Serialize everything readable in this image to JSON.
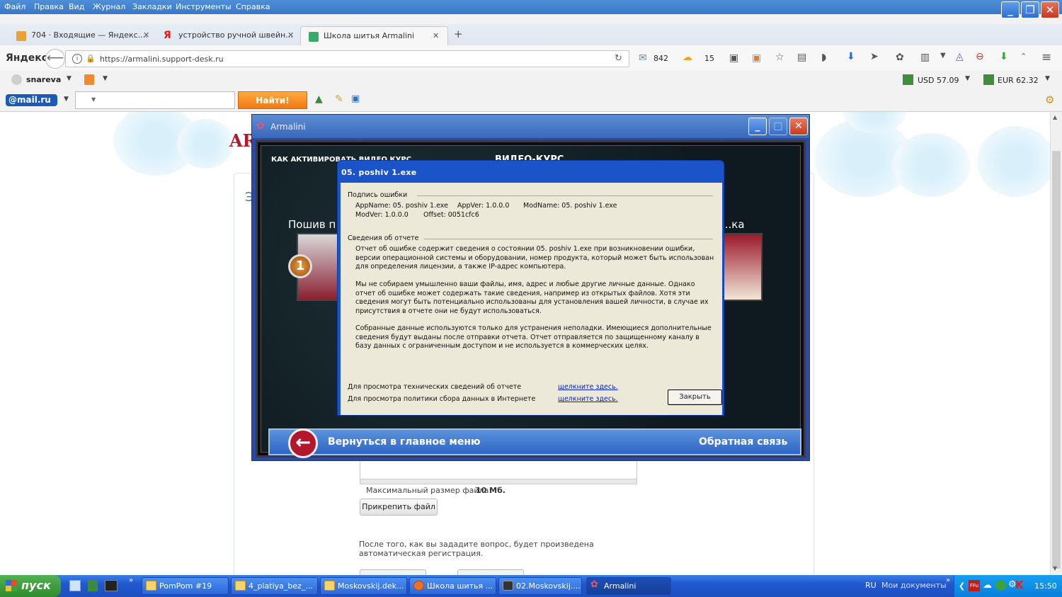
{
  "browser": {
    "menu": [
      "Файл",
      "Правка",
      "Вид",
      "Журнал",
      "Закладки",
      "Инструменты",
      "Справка"
    ],
    "tabs": [
      {
        "label": "704 · Входящие — Яндекс...."
      },
      {
        "label": "устройство ручной швейн..."
      },
      {
        "label": "Школа шитья Armalini"
      }
    ],
    "new_tab": "+",
    "yandex_label": "Яндекс",
    "url": "https://armalini.support-desk.ru",
    "mail_count": "842",
    "weather": "15",
    "user": "snareva",
    "usd": "USD 57.09",
    "eur": "EUR 62.32",
    "mailru_label": "@mail.ru",
    "search_value": "",
    "find_button": "Найти!"
  },
  "page": {
    "logo_partial": "AR",
    "cut_text": "Э",
    "max_file_size_label": "Максимальный размер файла:",
    "max_file_size_value": "10 Мб.",
    "attach_button": "Прикрепить файл",
    "note": "После того, как вы зададите вопрос, будет произведена автоматическая регистрация."
  },
  "app_window": {
    "title": "Armalini",
    "how_to_activate": "КАК АКТИВИРОВАТЬ ВИДЕО КУРС",
    "video_header": "ВИДЕО-КУРС",
    "left_item": "Пошив п..",
    "right_item": "...ка",
    "item_number": "1",
    "back_label": "Вернуться в главное меню",
    "feedback_label": "Обратная связь"
  },
  "dialog": {
    "title": "05. poshiv 1.exe",
    "signature_header": "Подпись ошибки",
    "sig_line1_appname": "AppName: 05. poshiv 1.exe",
    "sig_line1_appver": "AppVer: 1.0.0.0",
    "sig_line1_modname": "ModName: 05. poshiv 1.exe",
    "sig_line2_modver": "ModVer: 1.0.0.0",
    "sig_line2_offset": "Offset: 0051cfc6",
    "report_header": "Сведения об отчете",
    "para1": "Отчет об ошибке содержит сведения о состоянии 05. poshiv 1.exe при возникновении ошибки, версии операционной системы и оборудовании, номер продукта, который может быть использован для определения лицензии, а также IP-адрес компьютера.",
    "para2": "Мы не собираем умышленно ваши файлы, имя, адрес и любые другие личные данные. Однако отчет об ошибке может содержать такие сведения, например из открытых файлов. Хотя эти сведения могут быть потенциально использованы для установления вашей личности, в случае их присутствия в отчете они не будут использоваться.",
    "para3": "Собранные данные используются только для устранения неполадки. Имеющиеся дополнительные сведения будут выданы после отправки отчета. Отчет отправляется по защищенному каналу в базу данных с ограниченным доступом и не используется в коммерческих целях.",
    "tech_label": "Для просмотра технических сведений об отчете",
    "policy_label": "Для просмотра политики сбора данных в Интернете",
    "link_text": "щелкните здесь.",
    "close_button": "Закрыть"
  },
  "taskbar": {
    "start": "пуск",
    "tasks": [
      {
        "label": "PomPom #19"
      },
      {
        "label": "4_platiya_bez_..."
      },
      {
        "label": "Moskovskij.dek..."
      },
      {
        "label": "Школа шитья ..."
      },
      {
        "label": "02.Moskovskij...."
      },
      {
        "label": "Armalini"
      }
    ],
    "lang": "RU",
    "my_docs": "Мои документы",
    "time": "15:50"
  },
  "colors": {
    "xp_blue": "#1b53c9",
    "dialog_bg": "#ece9d8",
    "find_orange": "#f07a12",
    "start_green": "#3a9a3a"
  }
}
